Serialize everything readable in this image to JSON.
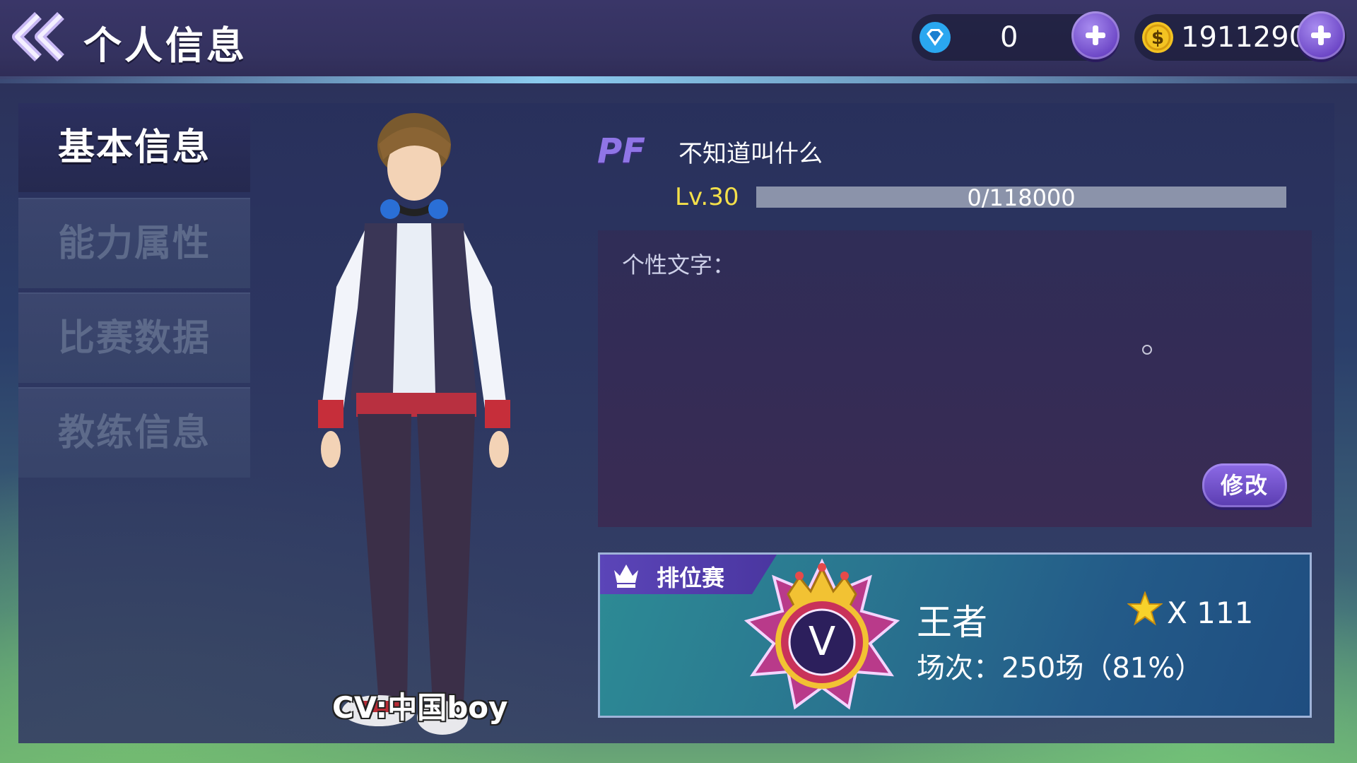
{
  "header": {
    "title": "个人信息",
    "back_icon": "double-chevron-left-icon"
  },
  "currency": {
    "gems": {
      "value": "0",
      "icon": "diamond-icon",
      "color": "#2aa7f0"
    },
    "gold": {
      "value": "1911290",
      "icon": "gold-coin-icon",
      "color": "#f3c322"
    }
  },
  "sidebar": {
    "tabs": [
      {
        "label": "基本信息",
        "active": true
      },
      {
        "label": "能力属性",
        "active": false
      },
      {
        "label": "比赛数据",
        "active": false
      },
      {
        "label": "教练信息",
        "active": false
      }
    ]
  },
  "character": {
    "cv_label": "CV:中国boy"
  },
  "profile": {
    "badge": "PF",
    "name": "不知道叫什么",
    "level": "Lv.30",
    "exp_text": "0/118000",
    "exp_progress": 0
  },
  "signature": {
    "label": "个性文字：",
    "edit_label": "修改"
  },
  "ranked": {
    "tag": "排位赛",
    "tier_letter": "V",
    "tier_name": "王者",
    "stars": "X 111",
    "matches": "场次：250场（81%）"
  },
  "colors": {
    "accent_purple": "#6c46c6",
    "level_yellow": "#f4e04a",
    "panel_dark": "#2b2f5e"
  }
}
